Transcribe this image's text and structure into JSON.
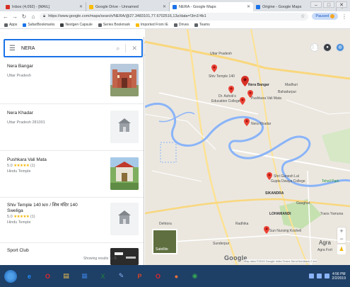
{
  "browser": {
    "tabs": [
      {
        "label": "Inbox (4,092) - [MAIL]",
        "color": "#d93025",
        "active": false
      },
      {
        "label": "Google Drive - Unnamed",
        "color": "#fbbc04",
        "active": false
      },
      {
        "label": "NERA - Google Maps",
        "color": "#1a73e8",
        "active": true
      },
      {
        "label": "Origine - Google Maps",
        "color": "#1a73e8",
        "active": false
      }
    ],
    "url": "https://www.google.com/maps/search/NERA/@27.3483101,77.6702516,13z/data=!3m1!4b1",
    "profile_label": "Paused",
    "bookmarks": [
      {
        "label": "Apps",
        "color": "#5f6368"
      },
      {
        "label": "SafariBookmarks",
        "color": "#1a73e8"
      },
      {
        "label": "Nextgen Capsule",
        "color": "#3c4043"
      },
      {
        "label": "Series Bookmark",
        "color": "#5f6368"
      },
      {
        "label": "Imported From IE",
        "color": "#fbbc04"
      },
      {
        "label": "Drives",
        "color": "#5f6368"
      },
      {
        "label": "Teams",
        "color": "#5f6368"
      }
    ]
  },
  "search": {
    "query": "NERA"
  },
  "results": [
    {
      "name": "Nera Bangar",
      "sub": "Uttar Pradesh",
      "rating": "",
      "stars": "",
      "type": "",
      "thumb": "fort"
    },
    {
      "name": "Nera Khadar",
      "sub": "Uttar Pradesh 281001",
      "rating": "",
      "stars": "",
      "type": "",
      "thumb": "placeholder"
    },
    {
      "name": "Pushkara Vali Mata",
      "sub": "",
      "rating": "5.0",
      "stars": "★★★★★",
      "count": "(1)",
      "type": "Hindu Temple",
      "thumb": "temple"
    },
    {
      "name": "Shiv Temple 140 km / शिव मंदिर 140 Sweliga",
      "sub": "",
      "rating": "5.0",
      "stars": "★★★★★",
      "count": "(1)",
      "type": "Hindu Temple",
      "thumb": "placeholder"
    },
    {
      "name": "Sport Club",
      "sub": "",
      "rating": "",
      "stars": "",
      "type": "",
      "thumb": "dark"
    }
  ],
  "results_footer": "Showing results 1 - 5",
  "map": {
    "labels": {
      "uttar_pradesh": "Uttar Pradesh",
      "shiv_temple": "Shiv Temple 140",
      "nera_bangar": "Nera Bangar",
      "madhuri": "Madhuri",
      "bahadurpur": "Bahadurpur",
      "dr_ashok": "Dr. Ashok's",
      "education_college": "Education College",
      "pushkara": "Pushkara Vali Mata",
      "nera_khadar": "Nera Khadar",
      "shri_ganesh": "Shri Ganesh Lal",
      "gupta_college": "Gupta Dwaya College",
      "sikandra": "SIKANDRA",
      "taj_mahal": "Tehsil Park",
      "agra": "Agra",
      "lohamandi": "LOHAMANDI",
      "sanjay": "Sun Nursing Kosheli",
      "trans_yamuna": "Trans Yamuna",
      "agra_fort": "Agra Fort",
      "radhika": "Radhika",
      "dehtora": "Dehtora",
      "sunder": "Sunderpur",
      "gaughat": "Gaughat"
    },
    "satellite_label": "Satellite",
    "google": "Google",
    "footer": "Map data ©2019 Google  India  Terms  Send feedback  2 km"
  },
  "taskbar": {
    "icons": [
      {
        "name": "ie-icon",
        "glyph": "e",
        "color": "#1e90ff"
      },
      {
        "name": "opera-icon",
        "glyph": "O",
        "color": "#e0262b"
      },
      {
        "name": "explorer-icon",
        "glyph": "▤",
        "color": "#f3c24e"
      },
      {
        "name": "store-icon",
        "glyph": "▦",
        "color": "#3a7bd5"
      },
      {
        "name": "excel-icon",
        "glyph": "X",
        "color": "#1e7145"
      },
      {
        "name": "paint-icon",
        "glyph": "✎",
        "color": "#8ab4f8"
      },
      {
        "name": "ppt-icon",
        "glyph": "P",
        "color": "#d24726"
      },
      {
        "name": "opera2-icon",
        "glyph": "O",
        "color": "#e0262b"
      },
      {
        "name": "firefox-icon",
        "glyph": "●",
        "color": "#ff7139"
      },
      {
        "name": "chrome-icon",
        "glyph": "◉",
        "color": "#34a853"
      }
    ],
    "time": "4:56 PM",
    "date": "2/2/2019"
  }
}
